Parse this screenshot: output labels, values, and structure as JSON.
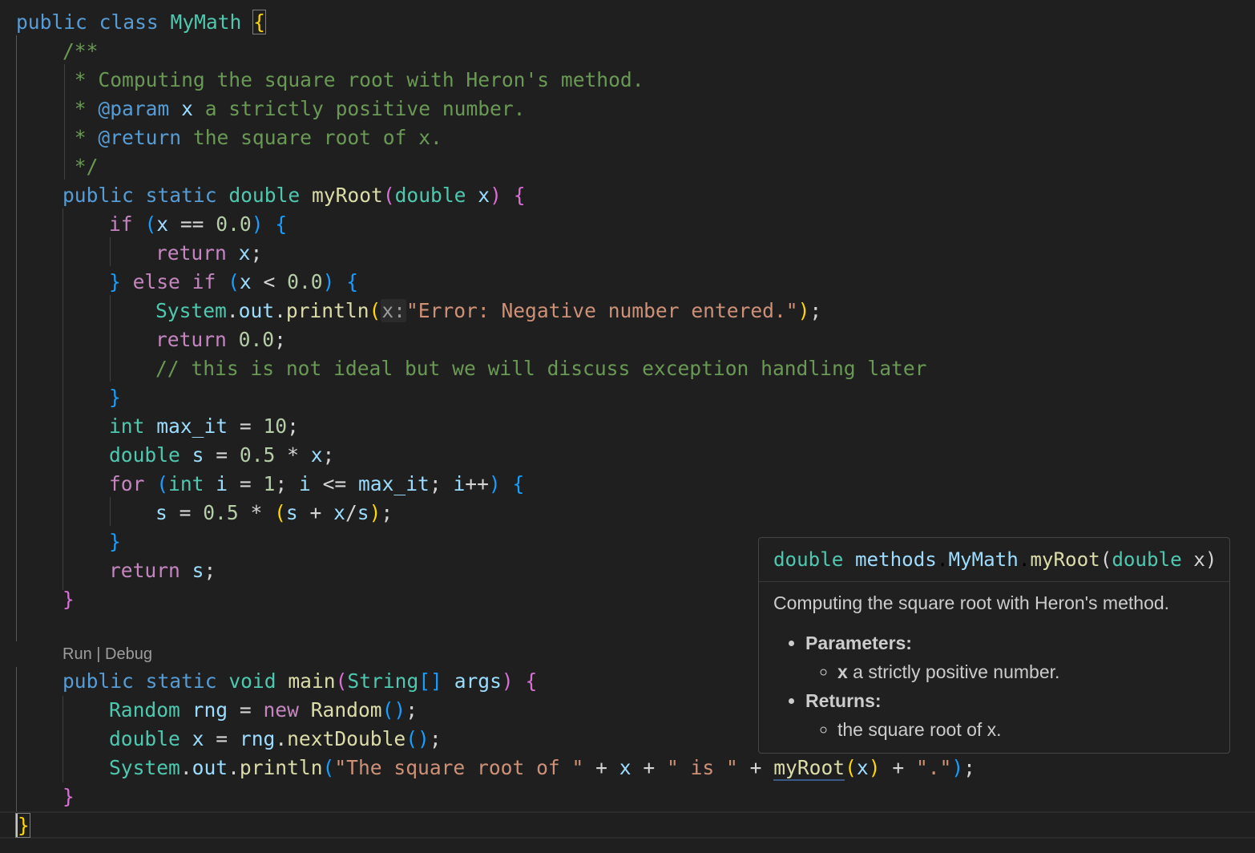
{
  "codelens": {
    "run": "Run",
    "sep": " | ",
    "debug": "Debug"
  },
  "tokens": {
    "public": "public",
    "class": "class",
    "static": "static",
    "double": "double",
    "void": "void",
    "int": "int",
    "if": "if",
    "else": "else",
    "for": "for",
    "return": "return",
    "new": "new",
    "MyMath": "MyMath",
    "myRoot": "myRoot",
    "main": "main",
    "System": "System",
    "out": "out",
    "println": "println",
    "String": "String",
    "args": "args",
    "Random": "Random",
    "rng": "rng",
    "nextDouble": "nextDouble",
    "x": "x",
    "s": "s",
    "i": "i",
    "max_it": "max_it",
    "zero": "0.0",
    "half": "0.5",
    "one": "1",
    "ten": "10",
    "error_msg": "\"Error: Negative number entered.\"",
    "str_sqrt": "\"The square root of \"",
    "str_is": "\" is \"",
    "str_dot": "\".\"",
    "inlay_hint": "x:"
  },
  "comments": {
    "doc_open": "/**",
    "doc_line1": " * Computing the square root with Heron's method.",
    "doc_param_star": " * ",
    "doc_param_tag": "@param",
    "doc_param_name": "x",
    "doc_param_text": " a strictly positive number.",
    "doc_return_star": " * ",
    "doc_return_tag": "@return",
    "doc_return_text": " the square root of x.",
    "doc_close": " */",
    "line_comment": "// this is not ideal but we will discuss exception handling later"
  },
  "hover": {
    "sig_type": "double",
    "sig_package": "methods",
    "sig_class": "MyMath",
    "sig_method": "myRoot",
    "sig_param_type": "double",
    "sig_param_name": "x",
    "description": "Computing the square root with Heron's method.",
    "params_label": "Parameters:",
    "param_name": "x",
    "param_desc": " a strictly positive number.",
    "returns_label": "Returns:",
    "returns_desc": "the square root of x."
  }
}
